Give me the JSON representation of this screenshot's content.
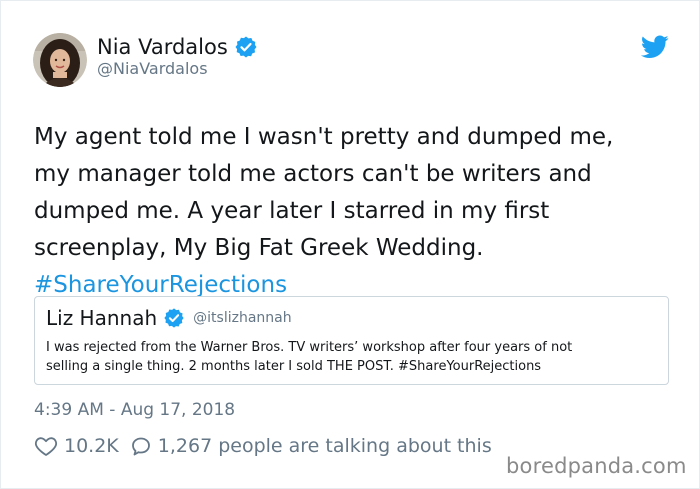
{
  "author": {
    "display_name": "Nia Vardalos",
    "handle": "@NiaVardalos",
    "avatar_icon": "avatar-photo",
    "verified_icon": "verified-badge-icon"
  },
  "tweet": {
    "text_lines": [
      "My agent told me I wasn't pretty and dumped me,",
      "my manager told me actors can't be writers and",
      "dumped me. A year later I starred in my first",
      "screenplay, My Big Fat Greek Wedding."
    ],
    "hashtag": "#ShareYourRejections"
  },
  "quoted_tweet": {
    "display_name": "Liz Hannah",
    "handle": "@itslizhannah",
    "text_line_1": "I was rejected from the Warner Bros. TV writers’ workshop after four years of not",
    "text_line_2": "selling a single thing. 2 months later I sold THE POST. #ShareYourRejections"
  },
  "timestamp": "4:39 AM - Aug 17, 2018",
  "actions": {
    "likes": "10.2K",
    "talking": "1,267 people are talking about this"
  },
  "watermark": "boredpanda.com",
  "colors": {
    "link": "#1b95e0",
    "secondary": "#657786",
    "verified": "#1da1f2"
  }
}
